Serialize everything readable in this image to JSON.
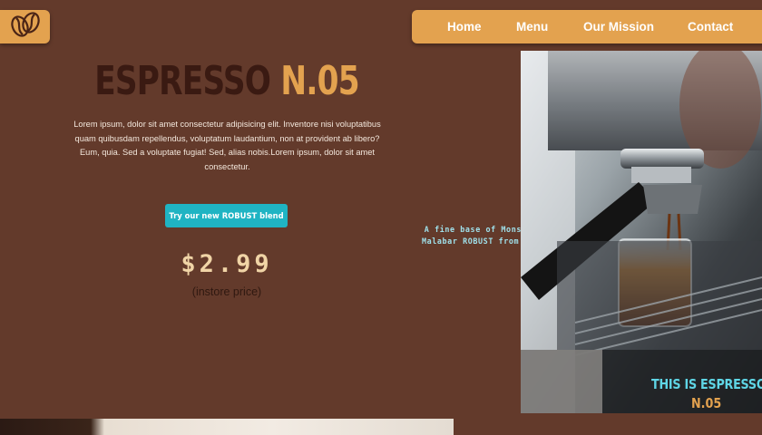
{
  "logo": {
    "icon": "coffee-beans-icon"
  },
  "nav": {
    "items": [
      {
        "label": "Home"
      },
      {
        "label": "Menu"
      },
      {
        "label": "Our Mission"
      },
      {
        "label": "Contact"
      }
    ]
  },
  "hero": {
    "title_main": "ESPRESSO",
    "title_accent": "N.05",
    "description": "Lorem ipsum, dolor sit amet consectetur adipisicing elit. Inventore nisi voluptatibus quam quibusdam repellendus, voluptatum laudantium, non at provident ab libero? Eum, quia. Sed a voluptate fugiat! Sed, alias nobis.Lorem ipsum, dolor sit amet consectetur.",
    "cta_label": "Try our new ROBUST blend",
    "price": "$2.99",
    "price_note": "(instore price)",
    "tagline": "A fine base of Monsooned Malabar ROBUST from India"
  },
  "photo": {
    "subject": "espresso-machine-photo",
    "caption_line1": "THIS IS ESPRESSO",
    "caption_line2": "N.05"
  },
  "colors": {
    "background": "#633a2b",
    "accent": "#e3a24f",
    "title_dark": "#3a1a12",
    "cta": "#1fb4c3",
    "caption": "#5fd6e6"
  }
}
